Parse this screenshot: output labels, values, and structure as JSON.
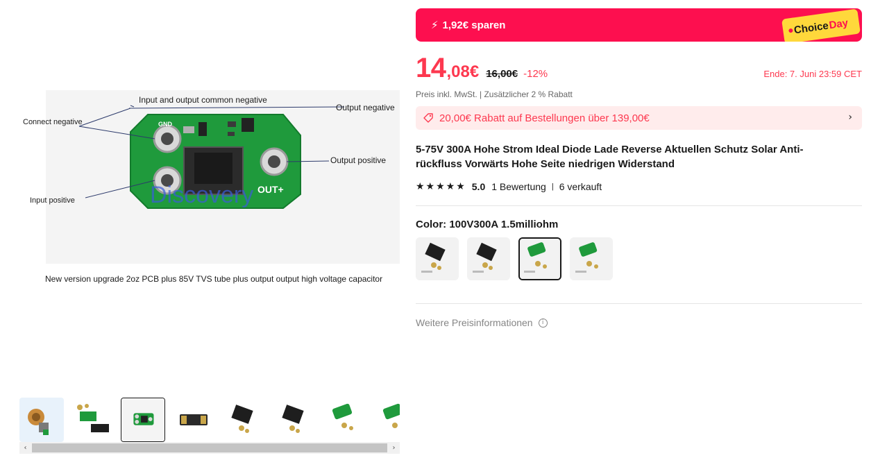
{
  "gallery": {
    "caption": "New version upgrade 2oz PCB plus 85V TVS tube plus output output high voltage capacitor",
    "annotations": {
      "common_negative": "Input and output common negative",
      "output_negative": "Output negative",
      "connect_negative": "Connect negative",
      "output_positive": "Output positive",
      "input_positive": "Input positive",
      "watermark": "Discovery",
      "silk_gnd": "GND",
      "silk_out": "OUT+"
    },
    "thumbnails": [
      {
        "icon": "rotor-thumb"
      },
      {
        "icon": "kit-thumb"
      },
      {
        "icon": "pcb-thumb",
        "selected": true
      },
      {
        "icon": "module-thumb"
      },
      {
        "icon": "case-thumb"
      },
      {
        "icon": "case-thumb"
      },
      {
        "icon": "pcb-kit-thumb"
      },
      {
        "icon": "pcb-kit-thumb"
      }
    ],
    "scroll_left": "‹",
    "scroll_right": "›"
  },
  "promo": {
    "savings": "1,92€ sparen",
    "choice_label": "Choice",
    "choice_day": "Day",
    "bolt_icon": "bolt-icon"
  },
  "price": {
    "integer": "14",
    "decimal": ",08€",
    "original": "16,00€",
    "discount": "-12%",
    "ends": "Ende: 7. Juni 23:59 CET",
    "tax_note": "Preis inkl. MwSt. | Zusätzlicher 2 % Rabatt"
  },
  "coupon": {
    "text": "20,00€ Rabatt auf Bestellungen über 139,00€"
  },
  "product": {
    "title": "5-75V 300A Hohe Strom Ideal Diode Lade Reverse Aktuellen Schutz Solar Anti-rückfluss Vorwärts Hohe Seite niedrigen Widerstand",
    "stars": "★★★★★",
    "rating": "5.0",
    "reviews": "1 Bewertung",
    "separator": "|",
    "sold": "6 verkauft"
  },
  "variants": {
    "label": "Color: 100V300A 1.5milliohm",
    "items": [
      {
        "icon": "case-variant",
        "selected": false
      },
      {
        "icon": "case-variant",
        "selected": false
      },
      {
        "icon": "pcb-variant",
        "selected": true
      },
      {
        "icon": "pcb-variant",
        "selected": false
      }
    ]
  },
  "more_info": "Weitere Preisinformationen",
  "colors": {
    "accent": "#fd384f",
    "banner": "#fd0f4f",
    "choice_yellow": "#ffd83b",
    "pcb_green": "#1f9a3c"
  }
}
